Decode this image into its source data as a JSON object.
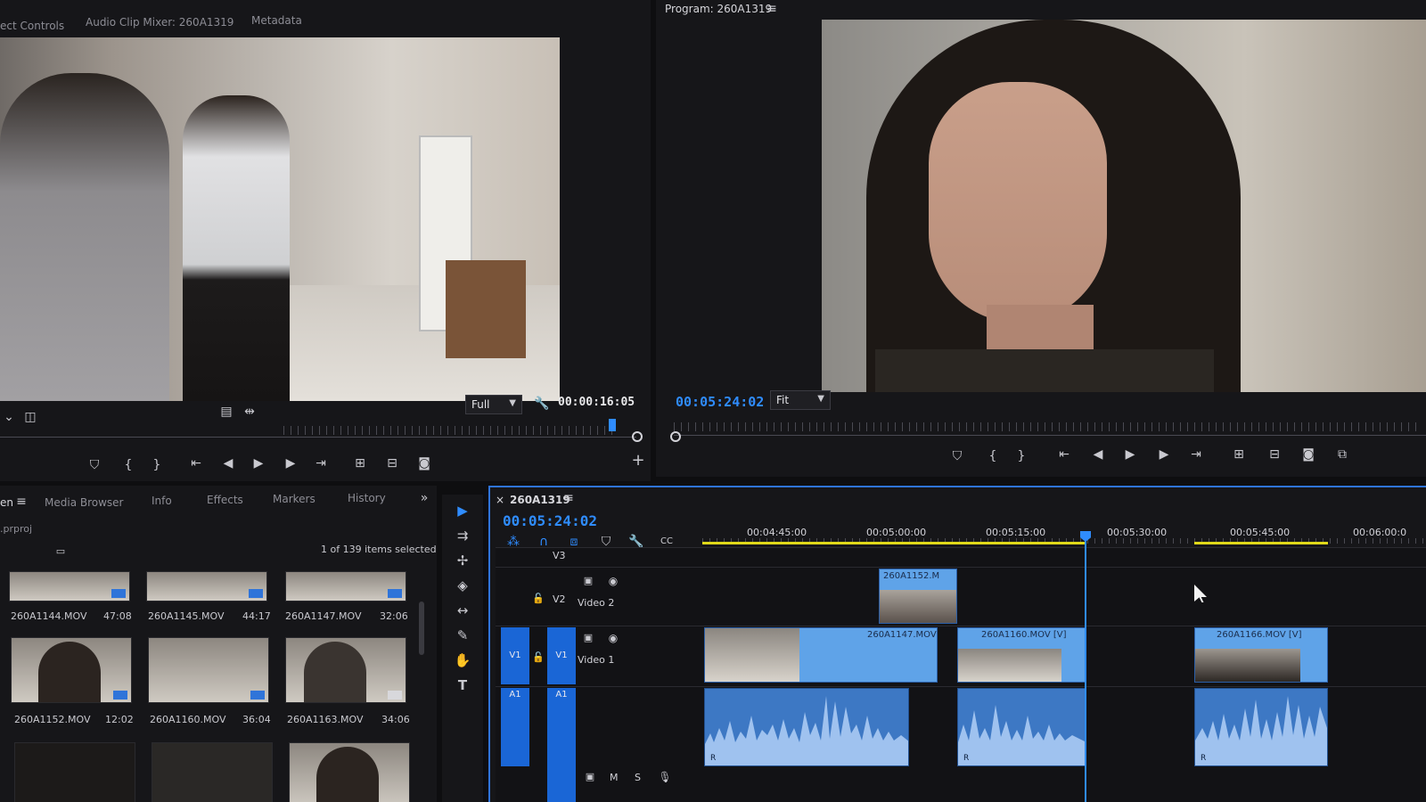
{
  "source_panel": {
    "tabs": [
      "ect Controls",
      "Audio Clip Mixer: 260A1319",
      "Metadata"
    ],
    "zoom_select": "Full",
    "timecode": "00:00:16:05"
  },
  "program_panel": {
    "title": "Program: 260A1319",
    "menu_icon": "hamburger-icon",
    "timecode": "00:05:24:02",
    "zoom_select": "Fit"
  },
  "project_panel": {
    "tabs": [
      "en",
      "Media Browser",
      "Info",
      "Effects",
      "Markers",
      "History"
    ],
    "project_file": ".prproj",
    "selection_status": "1 of 139 items selected",
    "items": [
      {
        "name": "260A1144.MOV",
        "duration": "47:08"
      },
      {
        "name": "260A1145.MOV",
        "duration": "44:17"
      },
      {
        "name": "260A1147.MOV",
        "duration": "32:06"
      },
      {
        "name": "260A1152.MOV",
        "duration": "12:02"
      },
      {
        "name": "260A1160.MOV",
        "duration": "36:04"
      },
      {
        "name": "260A1163.MOV",
        "duration": "34:06"
      }
    ]
  },
  "timeline": {
    "sequence_name": "260A1319",
    "close_label": "×",
    "timecode": "00:05:24:02",
    "ruler": [
      "00:04:45:00",
      "00:05:00:00",
      "00:05:15:00",
      "00:05:30:00",
      "00:05:45:00",
      "00:06:00:0"
    ],
    "tracks": {
      "v3": "V3",
      "v2": {
        "label": "V2",
        "name": "Video 2"
      },
      "v1": {
        "target": "V1",
        "label": "V1",
        "name": "Video 1"
      },
      "a1": {
        "target": "A1",
        "label": "A1"
      }
    },
    "clips": {
      "v2_1": "260A1152.M",
      "v1_1": "260A1147.MOV",
      "v1_2": "260A1160.MOV [V]",
      "v1_3": "260A1166.MOV [V]"
    },
    "audio_clip_mark": "R",
    "audio_bottom_labels": [
      "M",
      "S"
    ]
  },
  "colors": {
    "accent": "#2f8cff",
    "clip_video": "#5fa3e8",
    "clip_audio": "#3d78c4",
    "work_area": "#e0d81a"
  }
}
